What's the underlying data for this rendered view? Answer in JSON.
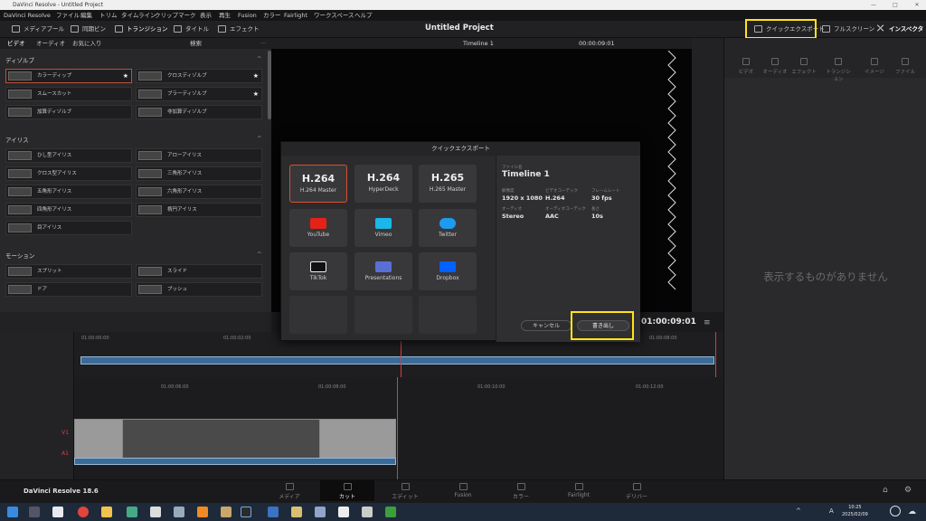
{
  "window": {
    "title": "DaVinci Resolve - Untitled Project"
  },
  "menu": [
    "DaVinci Resolve",
    "ファイル",
    "編集",
    "トリム",
    "タイムライン",
    "クリップ",
    "マーク",
    "表示",
    "再生",
    "Fusion",
    "カラー",
    "Fairlight",
    "ワークスペース",
    "ヘルプ"
  ],
  "toolbar": {
    "media_pool": "メディアプール",
    "sync_bin": "同期ビン",
    "transitions": "トランジション",
    "titles": "タイトル",
    "effects": "エフェクト",
    "project_title": "Untitled Project",
    "quick_export": "クイックエクスポート",
    "fullscreen": "フルスクリーン",
    "inspector": "インスペクタ"
  },
  "left_tabs": [
    "ビデオ",
    "オーディオ",
    "お気に入り"
  ],
  "search_label": "検索",
  "sections": {
    "dissolve": "ディゾルブ",
    "iris": "アイリス",
    "motion": "モーション"
  },
  "dissolve_items": [
    "カラーディップ",
    "クロスディゾルブ",
    "スムースカット",
    "ブラーディゾルブ",
    "加算ディゾルブ",
    "非加算ディゾルブ"
  ],
  "iris_items": [
    "ひし型アイリス",
    "アローアイリス",
    "クロス型アイリス",
    "三角形アイリス",
    "五角形アイリス",
    "六角形アイリス",
    "四角形アイリス",
    "楕円アイリス",
    "目アイリス"
  ],
  "motion_items": [
    "スプリット",
    "スライド",
    "ドア",
    "プッシュ"
  ],
  "viewer": {
    "timeline_name": "Timeline 1",
    "timecode": "00:00:09:01",
    "timecode_big": "01:00:09:01"
  },
  "dialog": {
    "title": "クイックエクスポート",
    "presets": [
      {
        "big": "H.264",
        "sub": "H.264 Master"
      },
      {
        "big": "H.264",
        "sub": "HyperDeck"
      },
      {
        "big": "H.265",
        "sub": "H.265 Master"
      },
      {
        "big": "",
        "sub": "YouTube",
        "color": "#e62117"
      },
      {
        "big": "",
        "sub": "Vimeo",
        "color": "#1ab7ea"
      },
      {
        "big": "",
        "sub": "Twitter",
        "color": "#1d9bf0"
      },
      {
        "big": "",
        "sub": "TikTok",
        "color": "#ffffff"
      },
      {
        "big": "",
        "sub": "Presentations",
        "color": "#5a6fd6"
      },
      {
        "big": "",
        "sub": "Dropbox",
        "color": "#0061fe"
      }
    ],
    "filename_label": "ファイル名",
    "filename": "Timeline 1",
    "res_label": "解像度",
    "res": "1920 x 1080",
    "vcodec_label": "ビデオコーデック",
    "vcodec": "H.264",
    "fps_label": "フレームレート",
    "fps": "30 fps",
    "audio_label": "オーディオ",
    "audio": "Stereo",
    "acodec_label": "オーディオコーデック",
    "acodec": "AAC",
    "len_label": "長さ",
    "len": "10s",
    "cancel": "キャンセル",
    "export": "書き出し"
  },
  "inspector": {
    "tabs": [
      "ビデオ",
      "オーディオ",
      "エフェクト",
      "トランジション",
      "イメージ",
      "ファイル"
    ],
    "empty": "表示するものがありません"
  },
  "timeline": {
    "ruler_top": [
      "01:00:00:00",
      "01:00:02:00",
      "01:00:08:00"
    ],
    "ruler_bottom": [
      "01:00:06:00",
      "01:00:08:00",
      "01:00:10:00",
      "01:00:12:00"
    ],
    "tracks": {
      "v1": "V1",
      "a1": "A1"
    }
  },
  "pages": [
    "メディア",
    "カット",
    "エディット",
    "Fusion",
    "カラー",
    "Fairlight",
    "デリバー"
  ],
  "brand": "DaVinci Resolve 18.6",
  "clock": {
    "time": "10:25",
    "date": "2025/02/09"
  },
  "ime": "A",
  "accent": "#ffe516"
}
